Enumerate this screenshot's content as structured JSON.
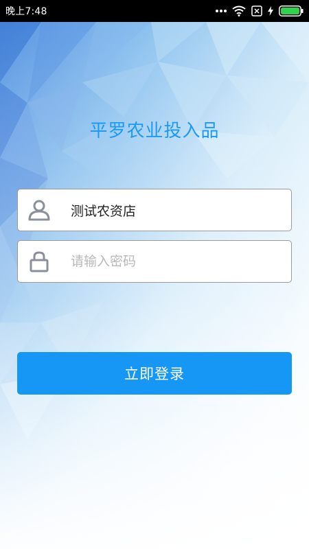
{
  "status_bar": {
    "time": "晚上7:48",
    "icons": [
      "more-dots-icon",
      "wifi-icon",
      "sim-blocked-icon",
      "charging-bolt-icon",
      "battery-icon"
    ]
  },
  "app": {
    "title": "平罗农业投入品"
  },
  "login_form": {
    "username": {
      "value": "测试农资店",
      "icon": "user-icon"
    },
    "password": {
      "value": "",
      "placeholder": "请输入密码",
      "icon": "lock-icon"
    },
    "submit_label": "立即登录"
  },
  "colors": {
    "accent": "#1a9af2",
    "button": "#1697f6",
    "icon_gray": "#8a8f9c",
    "battery_green": "#2fd24a",
    "status_bar": "#000000"
  }
}
